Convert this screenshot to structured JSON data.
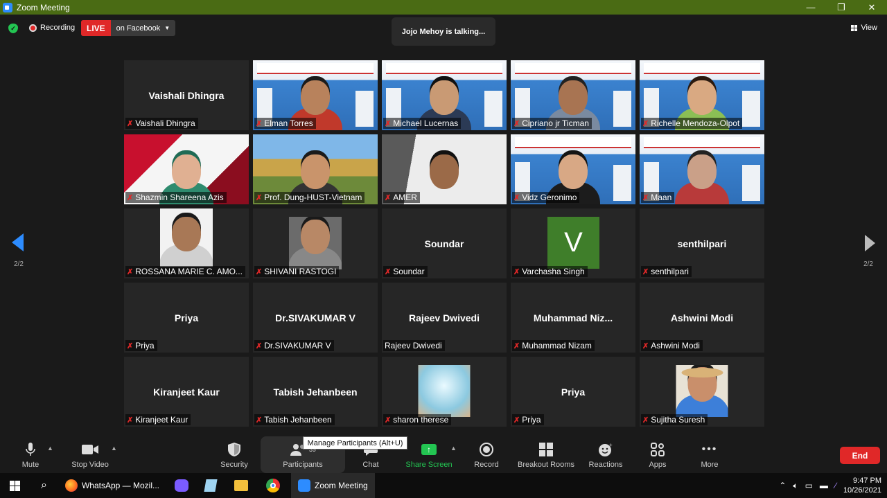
{
  "window": {
    "title": "Zoom Meeting",
    "minimize": "—",
    "restore": "❐",
    "close": "✕"
  },
  "topbar": {
    "recording_label": "Recording",
    "live_badge": "LIVE",
    "live_target": "on Facebook",
    "talking_banner": "Jojo Mehoy is talking...",
    "view_label": "View"
  },
  "pager": {
    "left": "2/2",
    "right": "2/2"
  },
  "tiles": [
    {
      "big": "Vaishali Dhingra",
      "name": "Vaishali Dhingra",
      "muted": true,
      "kind": "text"
    },
    {
      "big": "",
      "name": "Elman Torres",
      "muted": true,
      "kind": "conf",
      "skin": "#b8825c",
      "shirt": "#c0392b",
      "hair": "#1b1b1b"
    },
    {
      "big": "",
      "name": "Michael Lucernas",
      "muted": true,
      "kind": "conf",
      "skin": "#c99a74",
      "shirt": "#2b3a55",
      "hair": "#111"
    },
    {
      "big": "",
      "name": "Cipriano jr Ticman",
      "muted": true,
      "kind": "conf",
      "skin": "#a87452",
      "shirt": "#7a8aa0",
      "hair": "#222"
    },
    {
      "big": "",
      "name": "Richelle Mendoza-Olpot",
      "muted": true,
      "kind": "conf",
      "skin": "#d9a982",
      "shirt": "#8bbf55",
      "hair": "#2a1a10"
    },
    {
      "big": "",
      "name": "Shazmin Shareena Azis",
      "muted": true,
      "kind": "utm",
      "skin": "#e0b092",
      "shirt": "#2e8b6e",
      "hair": "#1f6b55"
    },
    {
      "big": "",
      "name": "Prof. Dung-HUST-Vietnam",
      "muted": true,
      "kind": "outdoor",
      "skin": "#c9946b",
      "shirt": "#333",
      "hair": "#1b1b1b"
    },
    {
      "big": "",
      "name": "AMER",
      "muted": true,
      "kind": "room",
      "skin": "#9b6a48",
      "shirt": "#ececec",
      "hair": "#111"
    },
    {
      "big": "",
      "name": "Vidz Geronimo",
      "muted": true,
      "kind": "conf",
      "skin": "#d8a885",
      "shirt": "#1c1c1c",
      "hair": "#141414"
    },
    {
      "big": "",
      "name": "Maan",
      "muted": true,
      "kind": "conf",
      "skin": "#caa088",
      "shirt": "#b83a3a",
      "hair": "#222"
    },
    {
      "big": "",
      "name": "ROSSANA MARIE C. AMO...",
      "muted": true,
      "kind": "portrait",
      "skin": "#a87856",
      "shirt": "#d0d0d0",
      "hair": "#1a1a1a"
    },
    {
      "big": "",
      "name": "SHIVANI RASTOGI",
      "muted": true,
      "kind": "portrait2",
      "skin": "#b88866",
      "shirt": "#888",
      "hair": "#1a1a1a"
    },
    {
      "big": "Soundar",
      "name": "Soundar",
      "muted": true,
      "kind": "text"
    },
    {
      "big": "V",
      "name": "Varchasha Singh",
      "muted": true,
      "kind": "initial"
    },
    {
      "big": "senthilpari",
      "name": "senthilpari",
      "muted": true,
      "kind": "text"
    },
    {
      "big": "Priya",
      "name": "Priya",
      "muted": true,
      "kind": "text"
    },
    {
      "big": "Dr.SIVAKUMAR V",
      "name": "Dr.SIVAKUMAR V",
      "muted": true,
      "kind": "text"
    },
    {
      "big": "Rajeev Dwivedi",
      "name": "Rajeev Dwivedi",
      "muted": false,
      "kind": "text"
    },
    {
      "big": "Muhammad  Niz...",
      "name": "Muhammad Nizam",
      "muted": true,
      "kind": "text"
    },
    {
      "big": "Ashwini Modi",
      "name": "Ashwini Modi",
      "muted": true,
      "kind": "text"
    },
    {
      "big": "Kiranjeet Kaur",
      "name": "Kiranjeet Kaur",
      "muted": true,
      "kind": "text"
    },
    {
      "big": "Tabish Jehanbeen",
      "name": "Tabish Jehanbeen",
      "muted": true,
      "kind": "text"
    },
    {
      "big": "",
      "name": "sharon therese",
      "muted": true,
      "kind": "hand"
    },
    {
      "big": "Priya",
      "name": "Priya",
      "muted": true,
      "kind": "text"
    },
    {
      "big": "",
      "name": "Sujitha Suresh",
      "muted": true,
      "kind": "hat",
      "skin": "#c98f6b",
      "shirt": "#3d7fd9",
      "hair": "#1a1a1a"
    }
  ],
  "toolbar": {
    "mute": "Mute",
    "stop_video": "Stop Video",
    "security": "Security",
    "participants": "Participants",
    "participants_count": "39",
    "chat": "Chat",
    "share_screen": "Share Screen",
    "record": "Record",
    "breakout": "Breakout Rooms",
    "reactions": "Reactions",
    "apps": "Apps",
    "more": "More",
    "end": "End",
    "tooltip": "Manage Participants (Alt+U)"
  },
  "taskbar": {
    "whatsapp": "WhatsApp — Mozil...",
    "zoom": "Zoom Meeting",
    "time": "9:47 PM",
    "date": "10/26/2021"
  },
  "colors": {
    "accent": "#2d8cff",
    "live": "#e02828",
    "share": "#23c552",
    "titlebar": "#4a6b14"
  }
}
